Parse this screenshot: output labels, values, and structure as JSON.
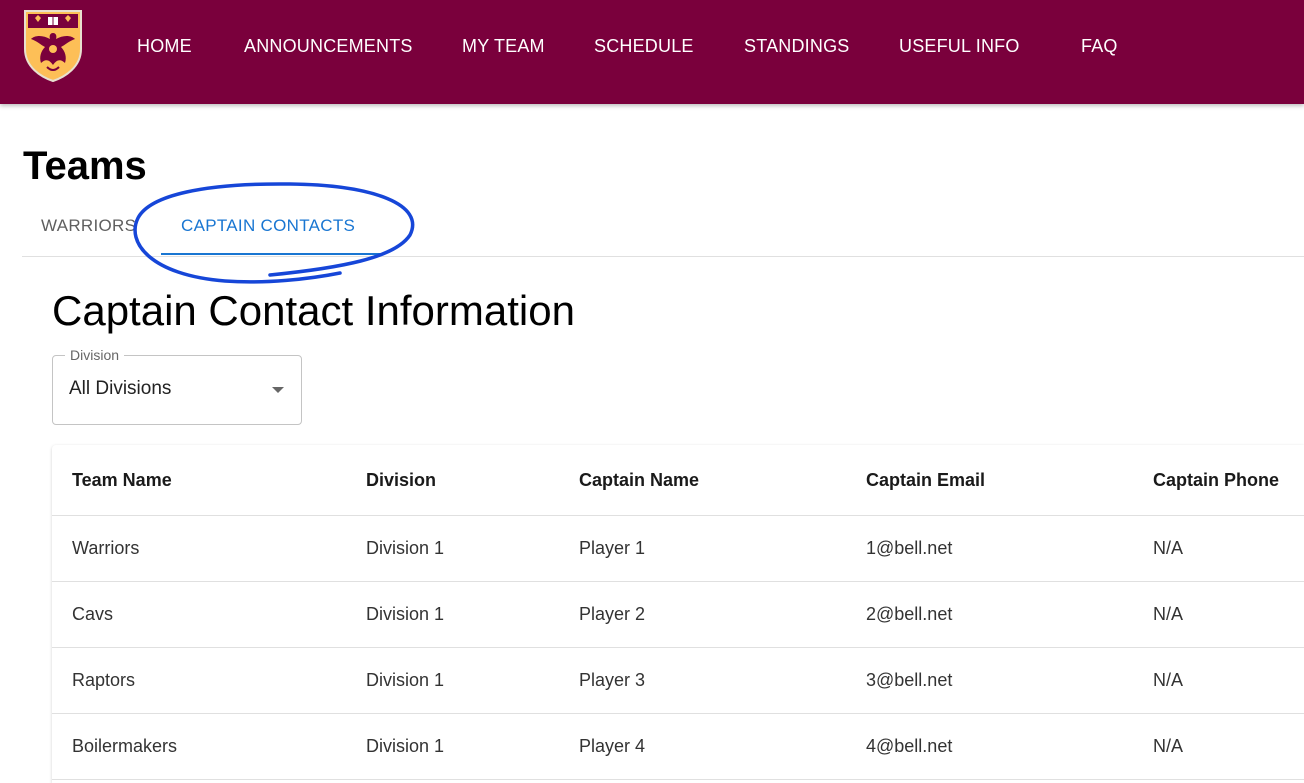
{
  "nav": {
    "items": [
      "HOME",
      "ANNOUNCEMENTS",
      "MY TEAM",
      "SCHEDULE",
      "STANDINGS",
      "USEFUL INFO",
      "FAQ"
    ]
  },
  "colors": {
    "brand": "#7a003c",
    "accent": "#1976d2",
    "crest_gold": "#fdbf57",
    "annotation": "#1646d8"
  },
  "page": {
    "title": "Teams"
  },
  "tabs": [
    {
      "label": "WARRIORS",
      "active": false
    },
    {
      "label": "CAPTAIN CONTACTS",
      "active": true
    }
  ],
  "section": {
    "title": "Captain Contact Information"
  },
  "division_select": {
    "label": "Division",
    "value": "All Divisions"
  },
  "table": {
    "headers": [
      "Team Name",
      "Division",
      "Captain Name",
      "Captain Email",
      "Captain Phone"
    ],
    "rows": [
      [
        "Warriors",
        "Division 1",
        "Player 1",
        "1@bell.net",
        "N/A"
      ],
      [
        "Cavs",
        "Division 1",
        "Player 2",
        "2@bell.net",
        "N/A"
      ],
      [
        "Raptors",
        "Division 1",
        "Player 3",
        "3@bell.net",
        "N/A"
      ],
      [
        "Boilermakers",
        "Division 1",
        "Player 4",
        "4@bell.net",
        "N/A"
      ]
    ]
  }
}
